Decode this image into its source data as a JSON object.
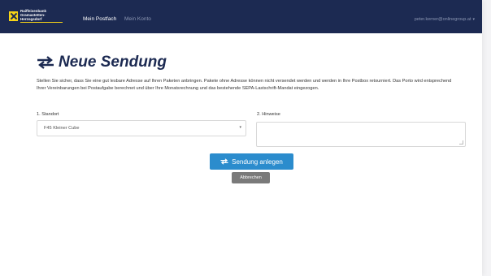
{
  "navbar": {
    "logo_line1": "Raiffeisenbank",
    "logo_line2": "Gramastetten-Herzogsdorf",
    "links": [
      "Mein Postfach",
      "Mein Konto"
    ],
    "user_email": "peter.kerner@onlinegroup.at"
  },
  "page": {
    "title": "Neue Sendung",
    "intro": "Stellen Sie sicher, dass Sie eine gut lesbare Adresse auf Ihren Paketen anbringen. Pakete ohne Adresse können nicht versendet werden und werden in Ihre Postbox retourniert. Das Porto wird entsprechend Ihrer Vereinbarungen bei Postaufgabe berechnet und über Ihre Monatsrechnung und das bestehende SEPA-Lastschrift-Mandat eingezogen."
  },
  "form": {
    "standort_label": "1. Standort",
    "standort_value": "F45 Kleiner Cube",
    "hinweise_label": "2. Hinweise",
    "hinweise_value": ""
  },
  "buttons": {
    "submit": "Sendung anlegen",
    "cancel": "Abbrechen"
  },
  "colors": {
    "navbar": "#1c2a52",
    "primary": "#2b8ccd",
    "secondary": "#7a7a7a",
    "logo_accent": "#f7d417"
  }
}
